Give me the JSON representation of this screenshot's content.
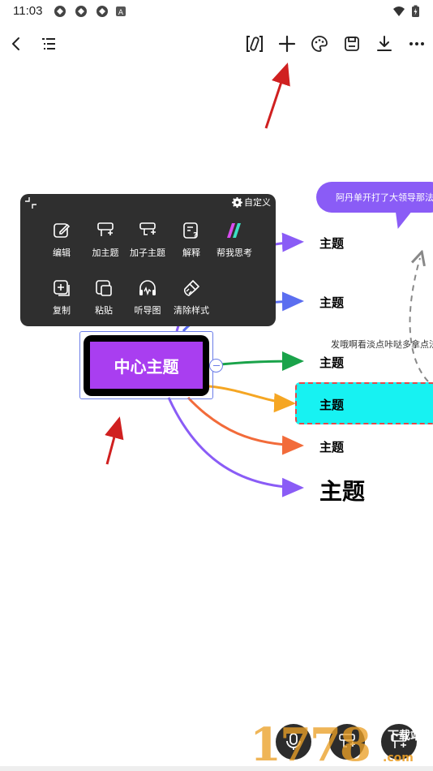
{
  "status_bar": {
    "time": "11:03",
    "icons": [
      "sync-icon",
      "sync-icon",
      "sync-icon",
      "a-badge-icon",
      "wifi-icon",
      "battery-charging-icon"
    ]
  },
  "toolbar": {
    "left": [
      "back-icon",
      "outline-list-icon"
    ],
    "right": [
      "slash-frame-icon",
      "plus-icon",
      "palette-icon",
      "save-icon",
      "download-icon",
      "more-icon"
    ]
  },
  "mindmap": {
    "center_topic": "中心主题",
    "topics": [
      "主题",
      "主题",
      "主题",
      "主题",
      "主题",
      "主题"
    ],
    "callout_text": "阿丹单开打了大领导那法",
    "note_text": "发哦啊看淡点咔哒多拿点法",
    "colors": {
      "center_fill": "#a93ef0",
      "branch_purple": "#8a5cf6",
      "branch_blue": "#5b6ef0",
      "branch_green": "#1aa34a",
      "branch_orange": "#f5a623",
      "branch_red": "#f26b3a",
      "selected_fill": "#17f2f2",
      "selected_border": "#e24a4a"
    }
  },
  "popup_menu": {
    "custom_label": "自定义",
    "row1": [
      {
        "label": "编辑",
        "icon": "edit-icon"
      },
      {
        "label": "加主题",
        "icon": "add-topic-icon"
      },
      {
        "label": "加子主题",
        "icon": "add-subtopic-icon"
      },
      {
        "label": "解释",
        "icon": "explain-icon"
      },
      {
        "label": "帮我思考",
        "icon": "ai-think-icon"
      }
    ],
    "row2": [
      {
        "label": "复制",
        "icon": "copy-icon"
      },
      {
        "label": "粘贴",
        "icon": "paste-icon"
      },
      {
        "label": "听导图",
        "icon": "headphones-icon"
      },
      {
        "label": "清除样式",
        "icon": "clear-style-icon"
      }
    ]
  },
  "watermark": {
    "number": "1778",
    "site": "下载站",
    "domain": ".com"
  }
}
